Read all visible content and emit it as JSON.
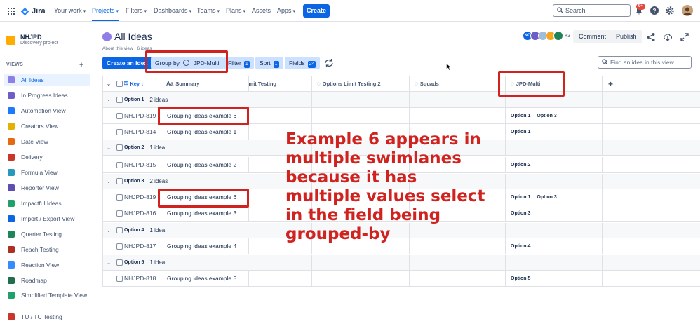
{
  "topnav": {
    "logo": "Jira",
    "items": [
      "Your work",
      "Projects",
      "Filters",
      "Dashboards",
      "Teams",
      "Plans",
      "Assets",
      "Apps"
    ],
    "create_label": "Create",
    "search_placeholder": "Search",
    "notification_count": "9+"
  },
  "sidebar": {
    "project_name": "NHJPD",
    "project_type": "Discovery project",
    "views_heading": "VIEWS",
    "items": [
      {
        "label": "All Ideas",
        "color": "#8f7ee7"
      },
      {
        "label": "In Progress Ideas",
        "color": "#6e5dc6"
      },
      {
        "label": "Automation View",
        "color": "#1d7afc"
      },
      {
        "label": "Creators View",
        "color": "#e2b203"
      },
      {
        "label": "Date View",
        "color": "#e56910"
      },
      {
        "label": "Delivery",
        "color": "#c9372c"
      },
      {
        "label": "Formula View",
        "color": "#2898bd"
      },
      {
        "label": "Reporter View",
        "color": "#5e4db2"
      },
      {
        "label": "Impactful Ideas",
        "color": "#22a06b"
      },
      {
        "label": "Import / Export View",
        "color": "#0c66e4"
      },
      {
        "label": "Quarter Testing",
        "color": "#1f845a"
      },
      {
        "label": "Reach Testing",
        "color": "#ae2e24"
      },
      {
        "label": "Reaction View",
        "color": "#388bff"
      },
      {
        "label": "Roadmap",
        "color": "#216e4e"
      },
      {
        "label": "Simplified Template View",
        "color": "#22a06b"
      },
      {
        "label": "TU / TC Testing",
        "color": "#c9372c"
      }
    ]
  },
  "header": {
    "title": "All Ideas",
    "about": "About this view · 6 ideas",
    "avatars": [
      "NC",
      "",
      "",
      "",
      ""
    ],
    "avatar_colors": [
      "#0c66e4",
      "#6e5dc6",
      "#a1bdd9",
      "#f5a623",
      "#1f845a"
    ],
    "extra_count": "+3",
    "comment_label": "Comment",
    "publish_label": "Publish"
  },
  "toolbar": {
    "create_idea": "Create an idea",
    "group_by_label": "Group by",
    "group_by_value": "JPD-Multi",
    "filter_label": "Filter",
    "filter_count": "1",
    "sort_label": "Sort",
    "sort_count": "1",
    "fields_label": "Fields",
    "fields_count": "24",
    "find_placeholder": "Find an idea in this view"
  },
  "table": {
    "columns": [
      "Key",
      "Summary",
      "Limit Testing",
      "Options Limit Testing 2",
      "Squads",
      "JPD-Multi"
    ],
    "groups": [
      {
        "name": "Option 1",
        "count": "2 ideas",
        "rows": [
          {
            "key": "NHJPD-819",
            "summary": "Grouping ideas example 6",
            "multi": [
              "Option 1",
              "Option 3"
            ]
          },
          {
            "key": "NHJPD-814",
            "summary": "Grouping ideas example 1",
            "multi": [
              "Option 1"
            ]
          }
        ]
      },
      {
        "name": "Option 2",
        "count": "1 idea",
        "rows": [
          {
            "key": "NHJPD-815",
            "summary": "Grouping ideas example 2",
            "multi": [
              "Option 2"
            ]
          }
        ]
      },
      {
        "name": "Option 3",
        "count": "2 ideas",
        "rows": [
          {
            "key": "NHJPD-819",
            "summary": "Grouping ideas example 6",
            "multi": [
              "Option 1",
              "Option 3"
            ]
          },
          {
            "key": "NHJPD-816",
            "summary": "Grouping ideas example 3",
            "multi": [
              "Option 3"
            ]
          }
        ]
      },
      {
        "name": "Option 4",
        "count": "1 idea",
        "rows": [
          {
            "key": "NHJPD-817",
            "summary": "Grouping ideas example 4",
            "multi": [
              "Option 4"
            ]
          }
        ]
      },
      {
        "name": "Option 5",
        "count": "1 idea",
        "rows": [
          {
            "key": "NHJPD-818",
            "summary": "Grouping ideas example 5",
            "multi": [
              "Option 5"
            ]
          }
        ]
      }
    ]
  },
  "annotation": "Example 6 appears in multiple swimlanes because it has multiple values select in the field being grouped-by"
}
